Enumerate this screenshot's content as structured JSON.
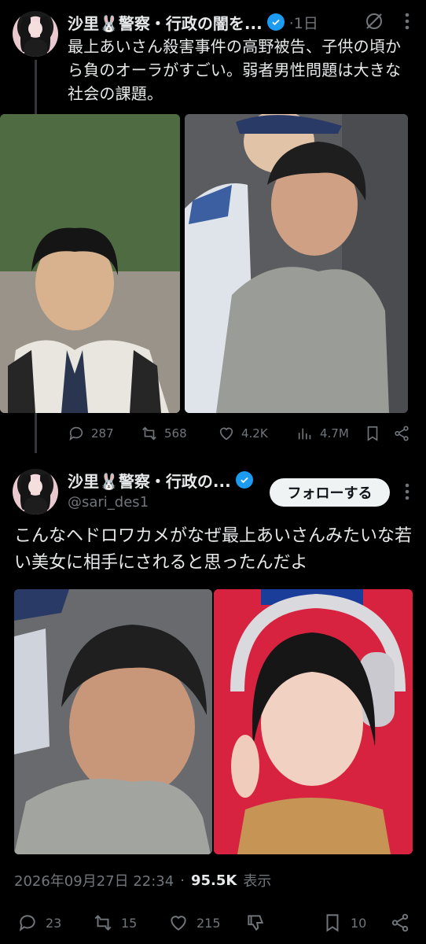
{
  "tweet1": {
    "display_name": "沙里🐰警察・行政の闇を...",
    "time": "·1日",
    "text": "最上あいさん殺害事件の高野被告、子供の頃から負のオーラがすごい。弱者男性問題は大きな社会の課題。",
    "actions": {
      "replies": "287",
      "retweets": "568",
      "likes": "4.2K",
      "views": "4.7M"
    }
  },
  "tweet2": {
    "display_name": "沙里🐰警察・行政の...",
    "handle": "@sari_des1",
    "follow_label": "フォローする",
    "text": "こんなヘドロワカメがなぜ最上あいさんみたいな若い美女に相手にされると思ったんだよ",
    "timestamp": "2026年09月27日 22:34",
    "separator": "·",
    "views_count": "95.5K",
    "views_label": "表示",
    "actions": {
      "replies": "23",
      "retweets": "15",
      "likes": "215",
      "bookmarks": "10"
    }
  },
  "colors": {
    "background": "#000000",
    "text": "#e7e9ea",
    "muted": "#71767b",
    "verified": "#1d9bf0",
    "follow_bg": "#eff3f4"
  },
  "icons": [
    "grok-icon",
    "more-icon",
    "reply-icon",
    "retweet-icon",
    "like-icon",
    "views-icon",
    "bookmark-icon",
    "share-icon",
    "downvote-icon",
    "verified-icon"
  ]
}
